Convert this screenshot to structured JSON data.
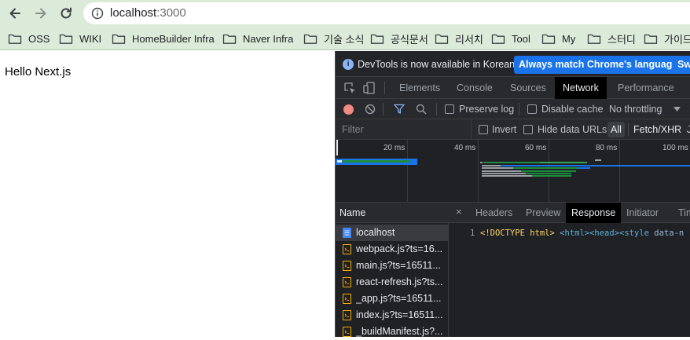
{
  "browser": {
    "url_host": "localhost",
    "url_port": ":3000",
    "bookmarks": [
      {
        "label": "OSS"
      },
      {
        "label": "WIKI"
      },
      {
        "label": "HomeBuilder Infra"
      },
      {
        "label": "Naver Infra"
      },
      {
        "label": "기술 소식"
      },
      {
        "label": "공식문서"
      },
      {
        "label": "리서치"
      },
      {
        "label": "Tool"
      },
      {
        "label": "My"
      },
      {
        "label": "스터디"
      },
      {
        "label": "가이드"
      }
    ]
  },
  "page": {
    "heading": "Hello Next.js"
  },
  "devtools": {
    "notice": {
      "message": "DevTools is now available in Korean!",
      "primary_button": "Always match Chrome's language",
      "secondary_button": "Swi"
    },
    "tabs": [
      "Elements",
      "Console",
      "Sources",
      "Network",
      "Performance"
    ],
    "active_tab": "Network",
    "network_toolbar": {
      "preserve_log": "Preserve log",
      "disable_cache": "Disable cache",
      "throttling": "No throttling"
    },
    "filter_bar": {
      "placeholder": "Filter",
      "invert": "Invert",
      "hide_data_urls": "Hide data URLs",
      "all": "All",
      "fetch_xhr": "Fetch/XHR",
      "js": "J"
    },
    "timeline_ticks": [
      "20 ms",
      "40 ms",
      "60 ms",
      "80 ms",
      "100 ms"
    ],
    "request_list": {
      "header": "Name",
      "items": [
        {
          "name": "localhost",
          "type": "document"
        },
        {
          "name": "webpack.js?ts=16...",
          "type": "script"
        },
        {
          "name": "main.js?ts=16511...",
          "type": "script"
        },
        {
          "name": "react-refresh.js?ts...",
          "type": "script"
        },
        {
          "name": "_app.js?ts=16511...",
          "type": "script"
        },
        {
          "name": "index.js?ts=16511...",
          "type": "script"
        },
        {
          "name": "_buildManifest.js?...",
          "type": "script"
        }
      ],
      "selected": "localhost"
    },
    "detail": {
      "close": "×",
      "tabs": [
        "Headers",
        "Preview",
        "Response",
        "Initiator",
        "Tim"
      ],
      "active_tab": "Response",
      "line_number": "1",
      "code_doctype": "<!DOCTYPE html>",
      "code_html": "<html>",
      "code_head": "<head>",
      "code_style_open": "<style ",
      "code_attr": "data-n"
    }
  },
  "colors": {
    "chrome_bg": "#dbead9",
    "devtools_bg": "#202124",
    "accent_blue": "#1a73e8",
    "record_red": "#f28b82"
  }
}
